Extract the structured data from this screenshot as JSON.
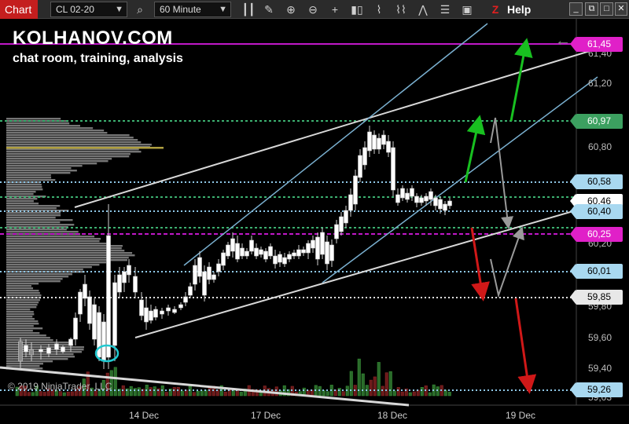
{
  "toolbar": {
    "tab_label": "Chart",
    "instrument": "CL 02-20",
    "interval": "60 Minute",
    "help_label": "Help",
    "z_label": "Z",
    "icons": [
      "search-icon",
      "bars-icon",
      "pencil-icon",
      "zoom-in-icon",
      "zoom-out-icon",
      "crosshair-icon",
      "chart-style-icon",
      "indicators-icon",
      "strategies-icon",
      "properties-icon",
      "snapshot-icon"
    ]
  },
  "overlay": {
    "brand": "KOLHANOV.COM",
    "subtitle": "chat room, training, analysis",
    "copyright": "© 2019 NinjaTrader, LLC"
  },
  "axis": {
    "y_ticks": [
      "61,40",
      "61,20",
      "60,80",
      "60,20",
      "59,80",
      "59,60",
      "59,40",
      "59,03"
    ],
    "x_ticks": [
      "14 Dec",
      "17 Dec",
      "18 Dec",
      "19 Dec"
    ]
  },
  "price_tags": [
    {
      "label": "61,45",
      "color": "#e020c8"
    },
    {
      "label": "60,97",
      "color": "#3ca060"
    },
    {
      "label": "60,58",
      "color": "#a8d8f0"
    },
    {
      "label": "60,46",
      "color": "#ffffff"
    },
    {
      "label": "60,40",
      "color": "#a8d8f0"
    },
    {
      "label": "60,25",
      "color": "#e020c8"
    },
    {
      "label": "60,01",
      "color": "#a8d8f0"
    },
    {
      "label": "59,85",
      "color": "#e8e8e8"
    },
    {
      "label": "59,26",
      "color": "#a8d8f0"
    }
  ],
  "colors": {
    "up_candle": "#ffffff",
    "down_candle": "#9a9a9a",
    "magenta_line": "#c018c8",
    "green_dotted": "#3cb070",
    "blue_dotted": "#8fc8e8",
    "channel": "#7ab0d0",
    "trendline": "#d8d8d8",
    "arrow_green": "#18c020",
    "arrow_red": "#d01818",
    "arrow_gray": "#9a9a9a"
  }
}
